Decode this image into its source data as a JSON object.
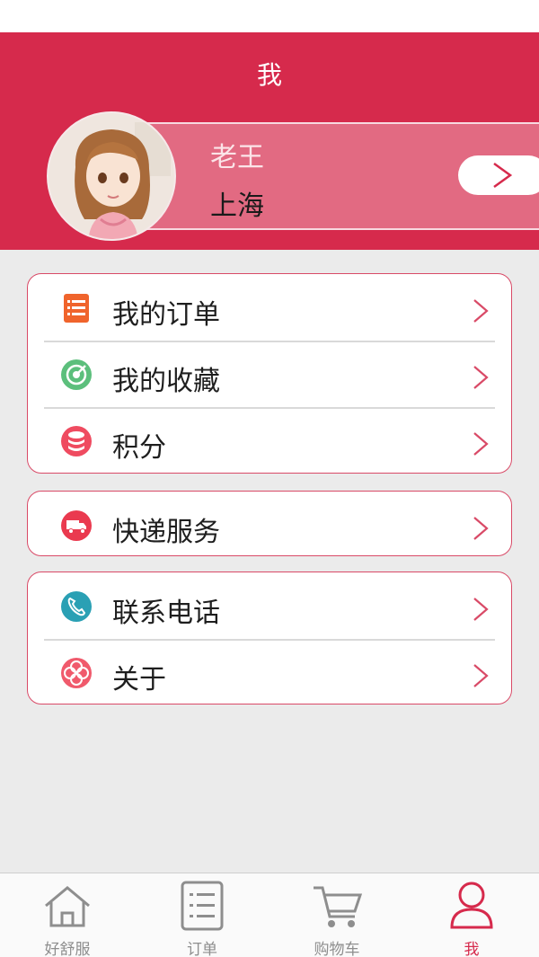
{
  "header": {
    "title": "我"
  },
  "profile": {
    "name": "老王",
    "city": "上海"
  },
  "menu_groups": [
    {
      "items": [
        {
          "label": "我的订单",
          "icon": "orders-icon",
          "color": "#f0642c"
        },
        {
          "label": "我的收藏",
          "icon": "favorites-icon",
          "color": "#5cbf7c"
        },
        {
          "label": "积分",
          "icon": "points-icon",
          "color": "#ef4b60"
        }
      ]
    },
    {
      "items": [
        {
          "label": "快递服务",
          "icon": "delivery-truck-icon",
          "color": "#ea3a4f"
        }
      ]
    },
    {
      "items": [
        {
          "label": "联系电话",
          "icon": "phone-icon",
          "color": "#2aa0b4"
        },
        {
          "label": "关于",
          "icon": "about-icon",
          "color": "#f05a6c"
        }
      ]
    }
  ],
  "tabbar": {
    "tabs": [
      {
        "label": "好舒服",
        "icon": "home-icon",
        "active": false
      },
      {
        "label": "订单",
        "icon": "list-icon",
        "active": false
      },
      {
        "label": "购物车",
        "icon": "cart-icon",
        "active": false
      },
      {
        "label": "我",
        "icon": "user-icon",
        "active": true
      }
    ]
  },
  "colors": {
    "accent": "#d62a4c",
    "background": "#ebebeb",
    "card_border": "#d94a67"
  }
}
